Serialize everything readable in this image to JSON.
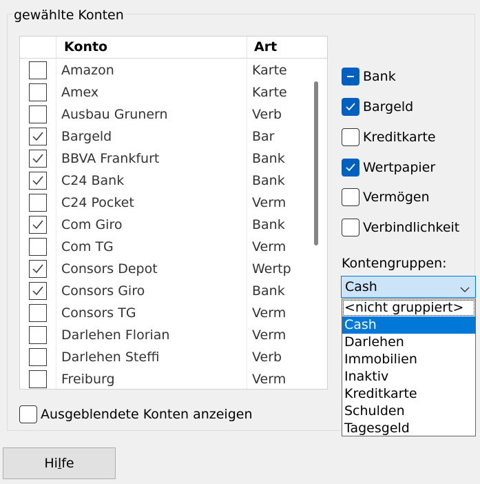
{
  "group": {
    "title": "gewählte Konten"
  },
  "table": {
    "columns": [
      "",
      "Konto",
      "Art"
    ],
    "rows": [
      {
        "name": "Amazon",
        "art": "Karte",
        "checked": false
      },
      {
        "name": "Amex",
        "art": "Karte",
        "checked": false
      },
      {
        "name": "Ausbau Grunern",
        "art": "Verb",
        "checked": false
      },
      {
        "name": "Bargeld",
        "art": "Bar",
        "checked": true
      },
      {
        "name": "BBVA Frankfurt",
        "art": "Bank",
        "checked": true
      },
      {
        "name": "C24 Bank",
        "art": "Bank",
        "checked": true
      },
      {
        "name": "C24 Pocket",
        "art": "Verm",
        "checked": false
      },
      {
        "name": "Com Giro",
        "art": "Bank",
        "checked": true
      },
      {
        "name": "Com TG",
        "art": "Verm",
        "checked": false
      },
      {
        "name": "Consors Depot",
        "art": "Wertp",
        "checked": true
      },
      {
        "name": "Consors Giro",
        "art": "Bank",
        "checked": true
      },
      {
        "name": "Consors TG",
        "art": "Verm",
        "checked": false
      },
      {
        "name": "Darlehen Florian",
        "art": "Verm",
        "checked": false
      },
      {
        "name": "Darlehen Steffi",
        "art": "Verb",
        "checked": false
      },
      {
        "name": "Freiburg",
        "art": "Verm",
        "checked": false
      }
    ]
  },
  "filters": [
    {
      "label": "Bank",
      "state": "indeterminate"
    },
    {
      "label": "Bargeld",
      "state": "checked"
    },
    {
      "label": "Kreditkarte",
      "state": "unchecked"
    },
    {
      "label": "Wertpapier",
      "state": "checked"
    },
    {
      "label": "Vermögen",
      "state": "unchecked"
    },
    {
      "label": "Verbindlichkeit",
      "state": "unchecked"
    }
  ],
  "kontengruppen": {
    "label": "Kontengruppen:",
    "selected": "Cash",
    "options": [
      "<nicht gruppiert>",
      "Cash",
      "Darlehen",
      "Immobilien",
      "Inaktiv",
      "Kreditkarte",
      "Schulden",
      "Tagesgeld"
    ]
  },
  "show_hidden": {
    "label": "Ausgeblendete Konten anzeigen",
    "checked": false
  },
  "help_button": {
    "label": "Hilfe",
    "mnemonic": "l"
  },
  "colors": {
    "accent": "#0060c0",
    "selection": "#0078d7",
    "combo_bg": "#cce4f7"
  },
  "icons": {
    "check": "checkmark-icon",
    "indeterminate": "minus-icon",
    "dropdown": "chevron-down-icon"
  }
}
